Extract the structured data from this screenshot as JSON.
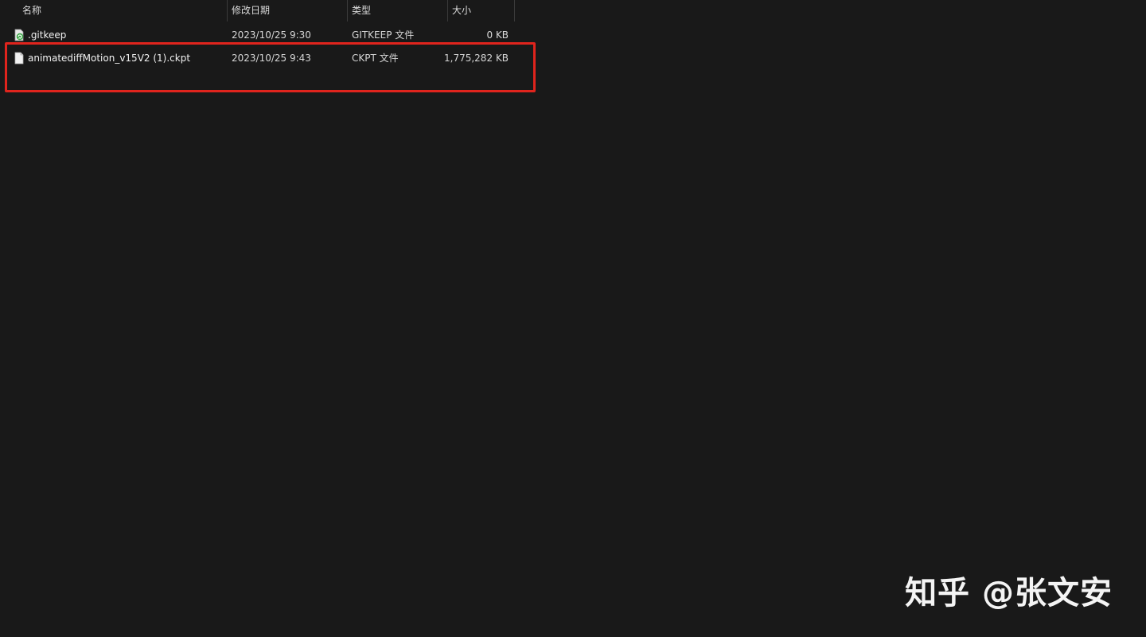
{
  "columns": {
    "name": "名称",
    "date": "修改日期",
    "type": "类型",
    "size": "大小"
  },
  "files": [
    {
      "name": ".gitkeep",
      "date": "2023/10/25 9:30",
      "type": "GITKEEP 文件",
      "size": "0 KB",
      "icon": "gitkeep-file-icon"
    },
    {
      "name": "animatediffMotion_v15V2 (1).ckpt",
      "date": "2023/10/25 9:43",
      "type": "CKPT 文件",
      "size": "1,775,282 KB",
      "icon": "file-icon"
    }
  ],
  "watermark": "知乎 @张文安",
  "colors": {
    "background": "#191919",
    "highlight": "#e0241d"
  }
}
